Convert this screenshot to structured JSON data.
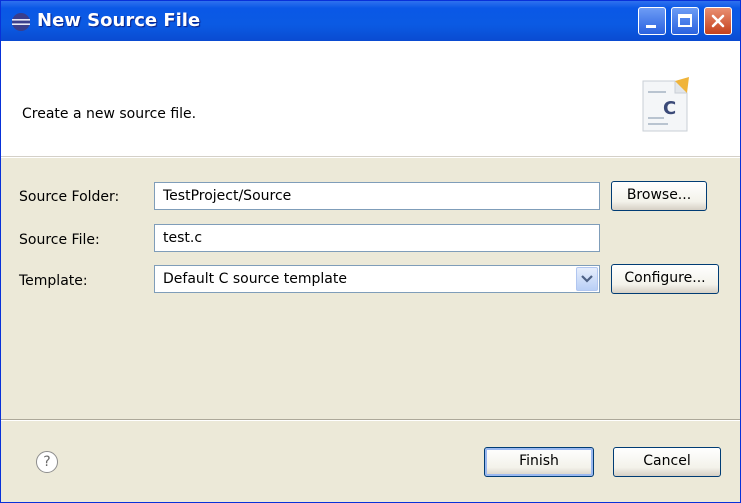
{
  "window": {
    "title": "New Source File",
    "icon": "eclipse-icon"
  },
  "header": {
    "message": "Create a new source file.",
    "image_icon": "c-source-file-icon",
    "image_letter": "C"
  },
  "form": {
    "source_folder": {
      "label": "Source Folder:",
      "value": "TestProject/Source",
      "button": "Browse..."
    },
    "source_file": {
      "label": "Source File:",
      "value": "test.c"
    },
    "template": {
      "label": "Template:",
      "value": "Default C source template",
      "button": "Configure..."
    }
  },
  "footer": {
    "help_glyph": "?",
    "finish": "Finish",
    "cancel": "Cancel"
  }
}
